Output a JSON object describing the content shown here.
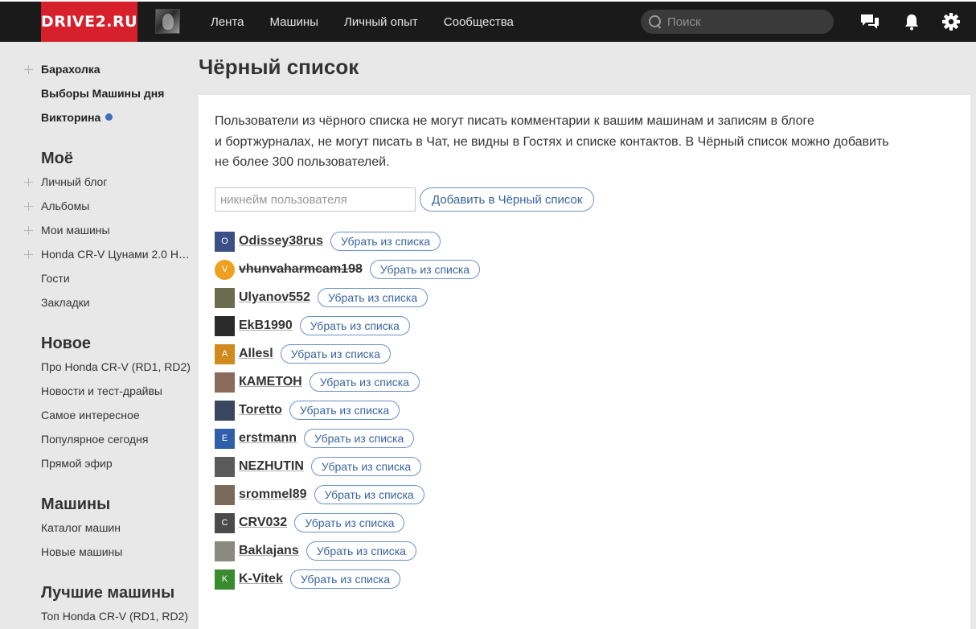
{
  "header": {
    "logo": "DRIVE2.RU",
    "nav": [
      "Лента",
      "Машины",
      "Личный опыт",
      "Сообщества"
    ],
    "search_placeholder": "Поиск"
  },
  "sidebar": {
    "top_items": [
      {
        "label": "Барахолка",
        "plus": true
      },
      {
        "label": "Выборы Машины дня",
        "plus": false
      },
      {
        "label": "Викторина",
        "plus": false,
        "dot": true
      }
    ],
    "sections": [
      {
        "title": "Моё",
        "items": [
          {
            "label": "Личный блог",
            "plus": true
          },
          {
            "label": "Альбомы",
            "plus": true
          },
          {
            "label": "Мои машины",
            "plus": true
          },
          {
            "label": "Honda CR-V Цунами 2.0 Н…",
            "plus": true
          },
          {
            "label": "Гости",
            "plus": false
          },
          {
            "label": "Закладки",
            "plus": false
          }
        ]
      },
      {
        "title": "Новое",
        "items": [
          {
            "label": "Про Honda CR-V (RD1, RD2)"
          },
          {
            "label": "Новости и тест-драйвы"
          },
          {
            "label": "Самое интересное"
          },
          {
            "label": "Популярное сегодня"
          },
          {
            "label": "Прямой эфир"
          }
        ]
      },
      {
        "title": "Машины",
        "items": [
          {
            "label": "Каталог машин"
          },
          {
            "label": "Новые машины"
          }
        ]
      },
      {
        "title": "Лучшие машины",
        "items": [
          {
            "label": "Топ Honda CR-V (RD1, RD2)"
          }
        ]
      }
    ]
  },
  "main": {
    "title": "Чёрный список",
    "description_lines": [
      "Пользователи из чёрного списка не могут писать комментарии к вашим машинам и записям в блоге",
      "и бортжурналах, не могут писать в Чат, не видны в Гостях и списке контактов. В Чёрный список можно добавить",
      "не более 300 пользователей."
    ],
    "input_placeholder": "никнейм пользователя",
    "add_button": "Добавить в Чёрный список",
    "remove_label": "Убрать из списка",
    "users": [
      {
        "name": "Odissey38rus",
        "avatar_letter": "O",
        "color": "#3c4f86",
        "strike": false
      },
      {
        "name": "vhunvaharmcam198",
        "avatar_letter": "V",
        "color": "#f0a020",
        "strike": true
      },
      {
        "name": "Ulyanov552",
        "avatar_letter": "",
        "color": "#6b6b4e",
        "strike": false
      },
      {
        "name": "EkB1990",
        "avatar_letter": "",
        "color": "#2a2a2a",
        "strike": false
      },
      {
        "name": "Allesl",
        "avatar_letter": "A",
        "color": "#d08a1e",
        "strike": false
      },
      {
        "name": "КАМЕТОН",
        "avatar_letter": "",
        "color": "#8a6a5a",
        "strike": false
      },
      {
        "name": "Toretto",
        "avatar_letter": "",
        "color": "#3a4660",
        "strike": false
      },
      {
        "name": "erstmann",
        "avatar_letter": "E",
        "color": "#2f5fa8",
        "strike": false
      },
      {
        "name": "NEZHUTIN",
        "avatar_letter": "",
        "color": "#5a5a5a",
        "strike": false
      },
      {
        "name": "srommel89",
        "avatar_letter": "",
        "color": "#7a6a5a",
        "strike": false
      },
      {
        "name": "CRV032",
        "avatar_letter": "C",
        "color": "#4a4a4a",
        "strike": false
      },
      {
        "name": "Baklajans",
        "avatar_letter": "",
        "color": "#8a8a80",
        "strike": false
      },
      {
        "name": "K-Vitek",
        "avatar_letter": "K",
        "color": "#3a8a2e",
        "strike": false
      }
    ]
  }
}
